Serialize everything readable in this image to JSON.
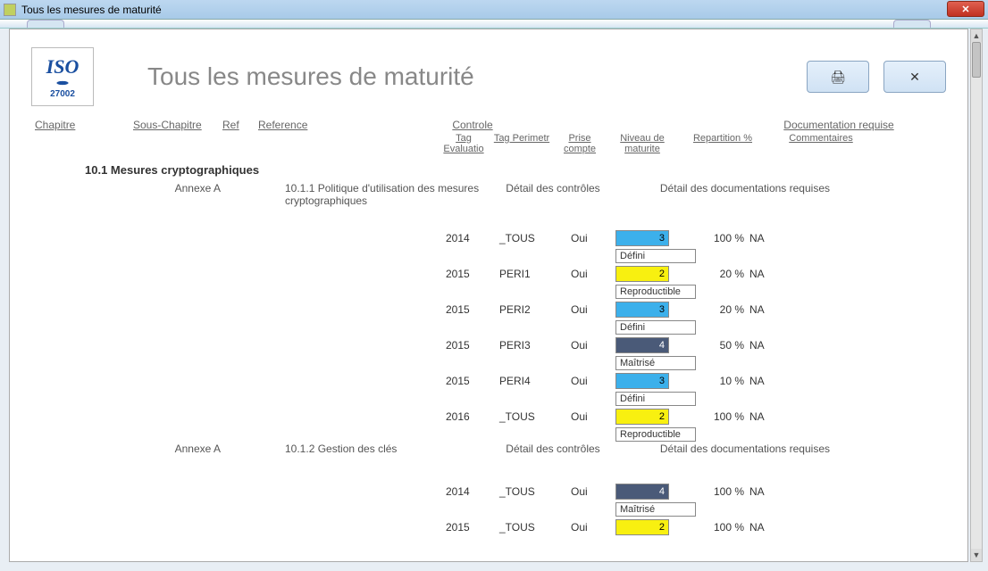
{
  "window": {
    "title": "Tous les mesures de maturité"
  },
  "logo": {
    "top": "ISO",
    "sub": "27002"
  },
  "page_title": "Tous les mesures de maturité",
  "buttons": {
    "print_icon": "🖨",
    "close_icon": "✕"
  },
  "cols": {
    "chapitre": "Chapitre",
    "sous": "Sous-Chapitre",
    "ref": "Ref",
    "reference": "Reference",
    "controle": "Controle",
    "doc": "Documentation requise"
  },
  "subcols": {
    "tag_eval": "Tag Evaluatio",
    "tag_peri": "Tag Perimetr",
    "prise": "Prise compte",
    "niveau": "Niveau de maturite",
    "repart": "Repartition %",
    "comment": "Commentaires"
  },
  "detail_controles": "Détail des contrôles",
  "detail_docs": "Détail des documentations requises",
  "section": "10.1 Mesures cryptographiques",
  "groups": [
    {
      "ann": "Annexe A",
      "ref": "10.1.1 Politique d'utilisation des mesures cryptographiques",
      "rows": [
        {
          "year": "2014",
          "peri": "_TOUS",
          "prise": "Oui",
          "val": "3",
          "color": "#3cb0eb",
          "pct": "100 %",
          "com": "NA",
          "lbl": "Défini"
        },
        {
          "year": "2015",
          "peri": "PERI1",
          "prise": "Oui",
          "val": "2",
          "color": "#f8f010",
          "pct": "20 %",
          "com": "NA",
          "lbl": "Reproductible"
        },
        {
          "year": "2015",
          "peri": "PERI2",
          "prise": "Oui",
          "val": "3",
          "color": "#3cb0eb",
          "pct": "20 %",
          "com": "NA",
          "lbl": "Défini"
        },
        {
          "year": "2015",
          "peri": "PERI3",
          "prise": "Oui",
          "val": "4",
          "color": "#4a5a78",
          "pct": "50 %",
          "com": "NA",
          "lbl": "Maîtrisé"
        },
        {
          "year": "2015",
          "peri": "PERI4",
          "prise": "Oui",
          "val": "3",
          "color": "#3cb0eb",
          "pct": "10 %",
          "com": "NA",
          "lbl": "Défini"
        },
        {
          "year": "2016",
          "peri": "_TOUS",
          "prise": "Oui",
          "val": "2",
          "color": "#f8f010",
          "pct": "100 %",
          "com": "NA",
          "lbl": "Reproductible"
        }
      ]
    },
    {
      "ann": "Annexe A",
      "ref": "10.1.2 Gestion des clés",
      "rows": [
        {
          "year": "2014",
          "peri": "_TOUS",
          "prise": "Oui",
          "val": "4",
          "color": "#4a5a78",
          "pct": "100 %",
          "com": "NA",
          "lbl": "Maîtrisé"
        },
        {
          "year": "2015",
          "peri": "_TOUS",
          "prise": "Oui",
          "val": "2",
          "color": "#f8f010",
          "pct": "100 %",
          "com": "NA",
          "lbl": ""
        }
      ]
    }
  ]
}
